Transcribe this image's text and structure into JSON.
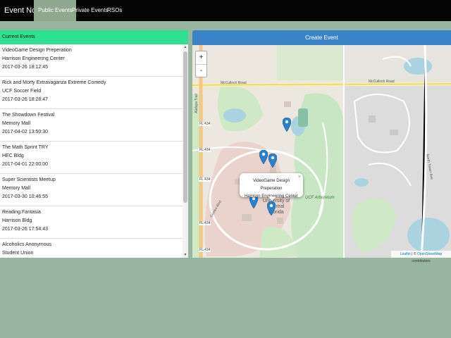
{
  "navbar": {
    "brand": "Event Note",
    "items": [
      "Public Events",
      "Private Events",
      "RSOs"
    ]
  },
  "events_panel": {
    "header": "Current Events",
    "events": [
      {
        "name": "VideoGame Design Preperation",
        "location": "Harrison Engineering Center",
        "datetime": "2017-03-26 18:12:45"
      },
      {
        "name": "Rick and Morty Extravaganza Extreme Comedy",
        "location": "UCF Soccer Field",
        "datetime": "2017-03-26 18:28:47"
      },
      {
        "name": "The Showdown Festival",
        "location": "Memory Mall",
        "datetime": "2017-04-02 13:50:30"
      },
      {
        "name": "The Math Sprint TRY",
        "location": "HEC Bldg",
        "datetime": "2017-04-01 22:00:00"
      },
      {
        "name": "Super Scientists Meetup",
        "location": "Memory Mall",
        "datetime": "2017-03-30 10:46:55"
      },
      {
        "name": "Reading Fantasia",
        "location": "Harrison Bldg",
        "datetime": "2017-03-26 17:54:43"
      },
      {
        "name": "Alcoholics Anonymous",
        "location": "Student Union",
        "datetime": ""
      }
    ]
  },
  "map_panel": {
    "create_button": "Create Event",
    "zoom_in": "+",
    "zoom_out": "-",
    "popup": {
      "line1": "VideoGame Design Preperation",
      "line2": "Harrison Engineering Center",
      "close": "×"
    },
    "labels": {
      "mcculloch_left": "McCulloch Road",
      "mcculloch_right": "McCulloch Road",
      "fl434_a": "FL 434",
      "fl434_b": "FL 434",
      "fl434_c": "FL 434",
      "fl434_d": "FL 434",
      "fl434_e": "FL 434",
      "alafaya": "Alafaya Trail",
      "arboretum": "UCF Arboretum",
      "university": "University of Central Florida",
      "north_tower": "North Tower Ave",
      "gemini": "Gemini Blvd"
    },
    "attribution": {
      "leaflet": "Leaflet",
      "sep": " | © ",
      "osm": "OpenStreetMap",
      "rest": " contributors"
    }
  },
  "colors": {
    "background": "#97b59f",
    "navbar": "#050505",
    "active_tab": "#8fa88f",
    "panel_header": "#2ee08f",
    "create_button": "#3b83c9",
    "marker": "#2a81cb"
  },
  "markers": [
    {
      "name": "marker-1"
    },
    {
      "name": "marker-2"
    },
    {
      "name": "marker-3"
    },
    {
      "name": "marker-4"
    },
    {
      "name": "marker-5"
    }
  ]
}
